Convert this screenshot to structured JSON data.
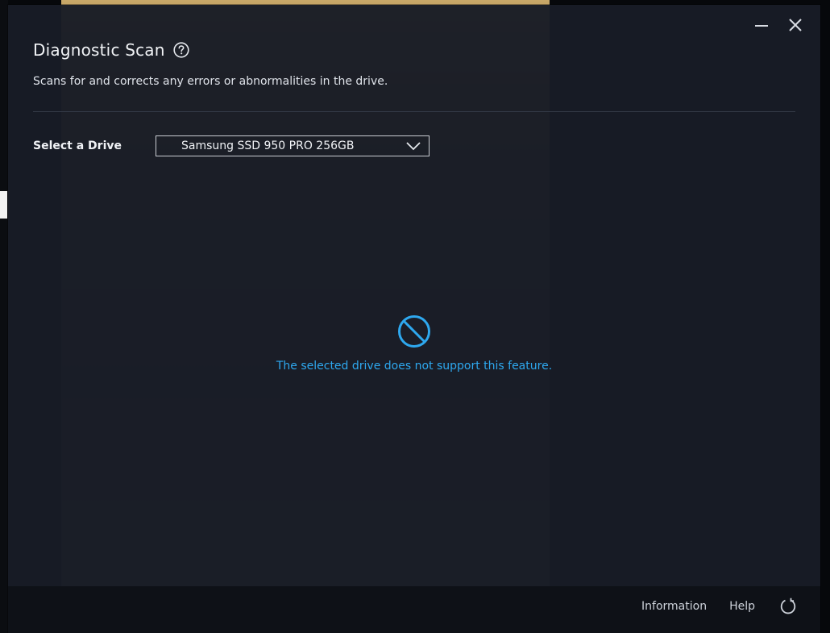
{
  "dialog": {
    "title": "Diagnostic Scan",
    "subtitle": "Scans for and corrects any errors or abnormalities in the drive."
  },
  "window_controls": {
    "minimize_icon": "minimize-icon",
    "close_icon": "close-icon"
  },
  "drive_selector": {
    "label": "Select a Drive",
    "selected": "Samsung SSD 950 PRO 256GB"
  },
  "status": {
    "icon": "no-entry-icon",
    "message": "The selected drive does not support this feature."
  },
  "footer": {
    "information_label": "Information",
    "help_label": "Help",
    "refresh_icon": "refresh-icon"
  },
  "colors": {
    "dialog_bg": "#181c26",
    "accent_blue": "#2ea8ef",
    "text_primary": "#f1f3f6",
    "footer_bg": "#0e1117"
  }
}
